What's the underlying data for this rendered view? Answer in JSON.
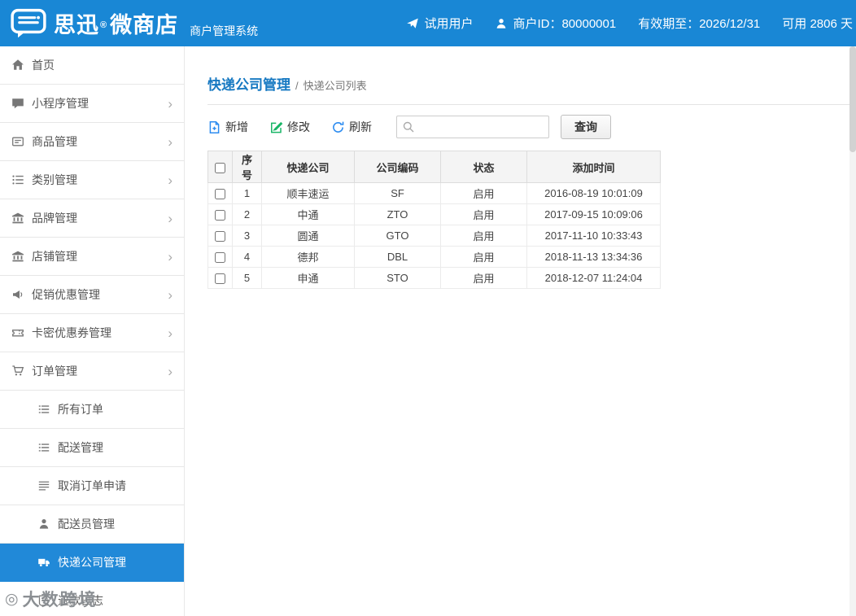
{
  "header": {
    "brand_name": "思迅",
    "brand_reg": "®",
    "brand_product": "微商店",
    "subtitle": "商户管理系统",
    "right_items": [
      {
        "label": "试用用户",
        "icon": "paper-plane-icon"
      },
      {
        "label": "商户ID：80000001",
        "icon": "user-icon"
      },
      {
        "label": "有效期至：2026/12/31",
        "icon": ""
      },
      {
        "label": "可用 2806 天",
        "icon": ""
      }
    ]
  },
  "sidebar": {
    "items": [
      {
        "label": "首页",
        "icon": "home-icon",
        "has_children": false
      },
      {
        "label": "小程序管理",
        "icon": "mini-program-icon",
        "has_children": true
      },
      {
        "label": "商品管理",
        "icon": "goods-icon",
        "has_children": true
      },
      {
        "label": "类别管理",
        "icon": "category-icon",
        "has_children": true
      },
      {
        "label": "品牌管理",
        "icon": "brand-icon",
        "has_children": true
      },
      {
        "label": "店铺管理",
        "icon": "shop-icon",
        "has_children": true
      },
      {
        "label": "促销优惠管理",
        "icon": "promotion-icon",
        "has_children": true
      },
      {
        "label": "卡密优惠券管理",
        "icon": "coupon-icon",
        "has_children": true
      },
      {
        "label": "订单管理",
        "icon": "order-icon",
        "has_children": true
      }
    ],
    "order_submenu": [
      {
        "label": "所有订单",
        "icon": "list-icon",
        "active": false
      },
      {
        "label": "配送管理",
        "icon": "list-icon",
        "active": false
      },
      {
        "label": "取消订单申请",
        "icon": "list-icon",
        "active": false
      },
      {
        "label": "配送员管理",
        "icon": "person-icon",
        "active": false
      },
      {
        "label": "快递公司管理",
        "icon": "truck-icon",
        "active": true
      },
      {
        "label": "退款日志",
        "icon": "log-icon",
        "active": false
      }
    ]
  },
  "main": {
    "title": "快递公司管理",
    "breadcrumb_separator": "/",
    "breadcrumb_current": "快递公司列表",
    "toolbar": {
      "add_label": "新增",
      "edit_label": "修改",
      "refresh_label": "刷新",
      "search_value": "",
      "query_label": "查询"
    },
    "table": {
      "headers": [
        "序号",
        "快递公司",
        "公司编码",
        "状态",
        "添加时间"
      ],
      "rows": [
        {
          "no": "1",
          "company": "顺丰速运",
          "code": "SF",
          "status": "启用",
          "added": "2016-08-19 10:01:09"
        },
        {
          "no": "2",
          "company": "中通",
          "code": "ZTO",
          "status": "启用",
          "added": "2017-09-15 10:09:06"
        },
        {
          "no": "3",
          "company": "圆通",
          "code": "GTO",
          "status": "启用",
          "added": "2017-11-10 10:33:43"
        },
        {
          "no": "4",
          "company": "德邦",
          "code": "DBL",
          "status": "启用",
          "added": "2018-11-13 13:34:36"
        },
        {
          "no": "5",
          "company": "申通",
          "code": "STO",
          "status": "启用",
          "added": "2018-12-07 11:24:04"
        }
      ]
    }
  },
  "watermark": {
    "text": "大数跨境"
  }
}
